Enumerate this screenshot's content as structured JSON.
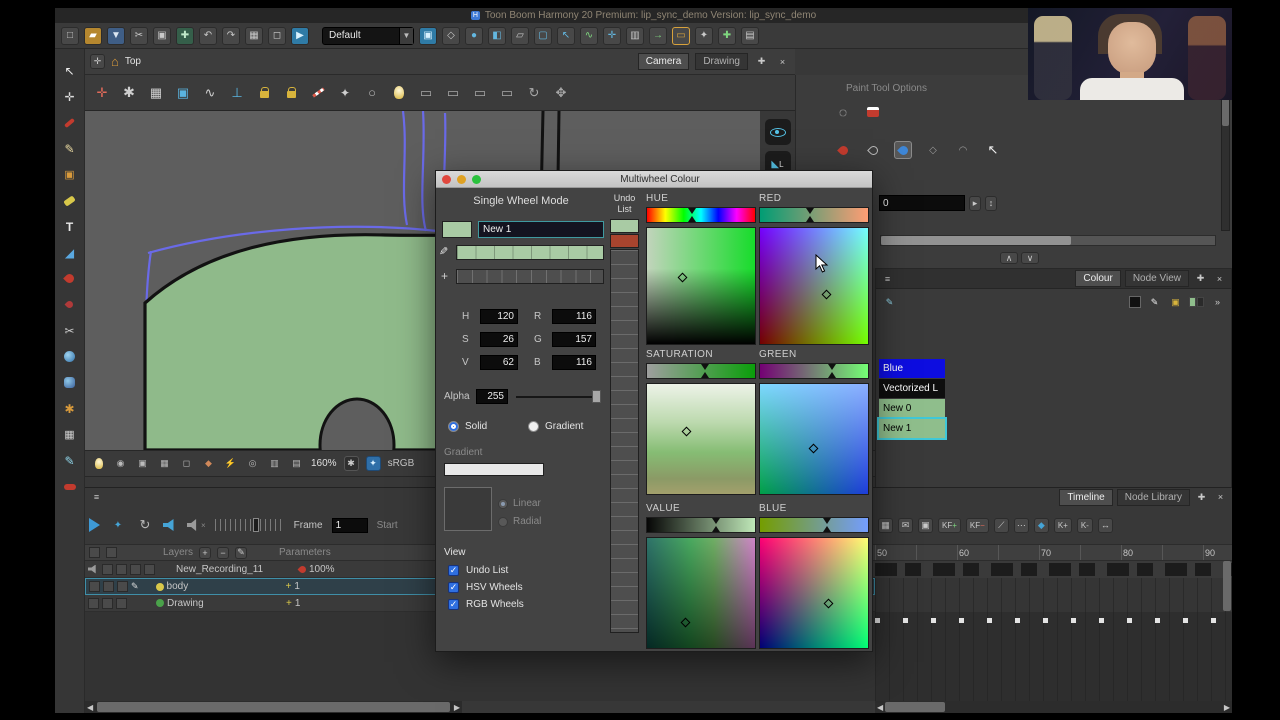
{
  "app": {
    "title": "Toon Boom Harmony 20 Premium: lip_sync_demo Version: lip_sync_demo",
    "workspace": "Default"
  },
  "nav": {
    "top_label": "Top",
    "camera_tab": "Camera",
    "drawing_tab": "Drawing"
  },
  "camera_status": {
    "zoom": "160%",
    "colorspace": "sRGB"
  },
  "paint_tool_options": {
    "title": "Paint Tool Options",
    "field_value": "0"
  },
  "colour_panel": {
    "tab_colour": "Colour",
    "tab_node_view": "Node View",
    "swatches": [
      {
        "name": "Blue",
        "bg": "#0d0de0",
        "fg": "#ffffff"
      },
      {
        "name": "Vectorized L",
        "bg": "#0e0e0e",
        "fg": "#ffffff"
      },
      {
        "name": "New 0",
        "bg": "#8fbe8c",
        "fg": "#000000"
      },
      {
        "name": "New 1",
        "bg": "#8fbe8c",
        "fg": "#000000"
      }
    ]
  },
  "dialog": {
    "title": "Multiwheel Colour",
    "mode_label": "Single Wheel Mode",
    "name_value": "New 1",
    "current_color": "#a9cba4",
    "undo_color_1": "#a9cba4",
    "undo_color_2": "#a8442e",
    "h_label": "H",
    "h_value": "120",
    "s_label": "S",
    "s_value": "26",
    "v_label": "V",
    "v_value": "62",
    "r_label": "R",
    "r_value": "116",
    "g_label": "G",
    "g_value": "157",
    "b_label": "B",
    "b_value": "116",
    "alpha_label": "Alpha",
    "alpha_value": "255",
    "solid_label": "Solid",
    "gradient_radio_label": "Gradient",
    "gradient_section_label": "Gradient",
    "linear_label": "Linear",
    "radial_label": "Radial",
    "view_label": "View",
    "undo_list_check": "Undo List",
    "hsv_wheels_check": "HSV Wheels",
    "rgb_wheels_check": "RGB Wheels",
    "undo_column_label": "Undo List",
    "wheel_labels": {
      "hue": "HUE",
      "red": "RED",
      "saturation": "SATURATION",
      "green": "GREEN",
      "value": "VALUE",
      "blue": "BLUE"
    }
  },
  "timeline": {
    "tab_timeline": "Timeline",
    "tab_node_library": "Node Library",
    "frame_label": "Frame",
    "frame_value": "1",
    "start_label": "Start",
    "layers_label": "Layers",
    "parameters_label": "Parameters",
    "kf_add": "KF",
    "kf_remove": "KF",
    "k_plus": "K+",
    "k_minus": "K-",
    "layers": [
      {
        "name": "New_Recording_11",
        "param": "100%"
      },
      {
        "name": "body",
        "param": "1"
      },
      {
        "name": "Drawing",
        "param": "1"
      }
    ],
    "ruler": [
      "50",
      "60",
      "70",
      "80",
      "90"
    ]
  },
  "colors": {
    "selection_teal": "#3fc8d8",
    "check_blue": "#2f6fe0",
    "current_swatch_green": "#a9cba4",
    "canvas_gray": "#5e5e5e",
    "character_green": "#8fba8a"
  }
}
